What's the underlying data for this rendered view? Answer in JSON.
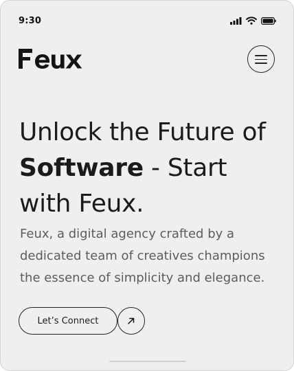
{
  "status_bar": {
    "time": "9:30",
    "icons": [
      "signal-icon",
      "wifi-icon",
      "battery-icon"
    ]
  },
  "header": {
    "logo_text": "Feux",
    "menu_icon": "hamburger-menu-icon"
  },
  "hero": {
    "headline_part1": "Unlock the Future of",
    "headline_bold": "Software",
    "headline_part2": " - Start with Feux.",
    "subtext": "Feux, a digital agency crafted by a dedicated team of creatives champions the essence of simplicity and elegance."
  },
  "cta": {
    "connect_label": "Let’s Connect",
    "arrow_icon": "arrow-up-right-icon"
  },
  "colors": {
    "background": "#efefef",
    "text": "#1b1b1b",
    "muted_text": "#5c5c5c"
  }
}
